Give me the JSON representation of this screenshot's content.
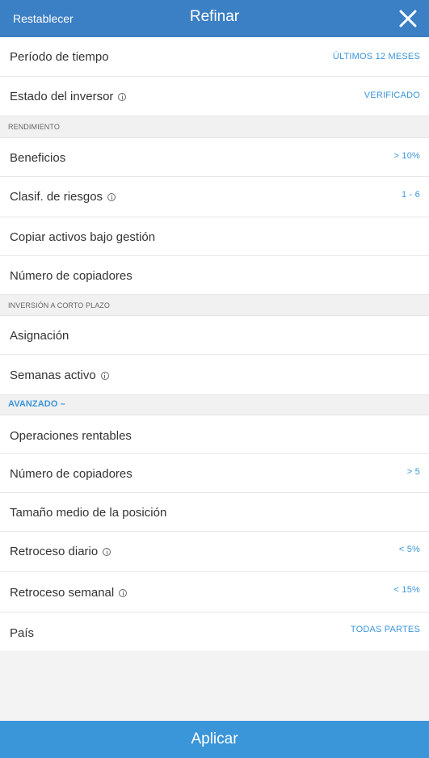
{
  "header": {
    "reset_label": "Restablecer",
    "title": "Refinar",
    "close_icon": "close-icon"
  },
  "rows": {
    "periodo": {
      "label": "Período de tiempo",
      "value": "ÚLTIMOS 12 MESES"
    },
    "estado": {
      "label": "Estado del inversor",
      "value": "VERIFICADO",
      "icon": "info-icon"
    },
    "sec_rendimiento": "RENDIMIENTO",
    "beneficios": {
      "label": "Beneficios",
      "value": "> 10%"
    },
    "riesgos": {
      "label": "Clasif. de riesgos",
      "value": "1 - 6",
      "icon": "info-icon"
    },
    "activos": {
      "label": "Copiar activos bajo gestión"
    },
    "copiadores1": {
      "label": "Número de copiadores"
    },
    "sec_corto": "INVERSIÓN A CORTO PLAZO",
    "asignacion": {
      "label": "Asignación"
    },
    "semanas": {
      "label": "Semanas activo",
      "icon": "info-icon"
    },
    "sec_avanzado": "AVANZADO –",
    "operaciones": {
      "label": "Operaciones rentables"
    },
    "copiadores2": {
      "label": "Número de copiadores",
      "value": "> 5"
    },
    "tamano": {
      "label": "Tamaño medio de la posición"
    },
    "diario": {
      "label": "Retroceso diario",
      "value": "< 5%",
      "icon": "info-icon"
    },
    "semanal": {
      "label": "Retroceso semanal",
      "value": "< 15%",
      "icon": "info-icon"
    },
    "pais": {
      "label": "País",
      "value": "TODAS PARTES"
    }
  },
  "footer": {
    "apply_label": "Aplicar"
  },
  "colors": {
    "header": "#3b7fc4",
    "accent": "#3b95d9",
    "footer": "#3b95d9"
  }
}
